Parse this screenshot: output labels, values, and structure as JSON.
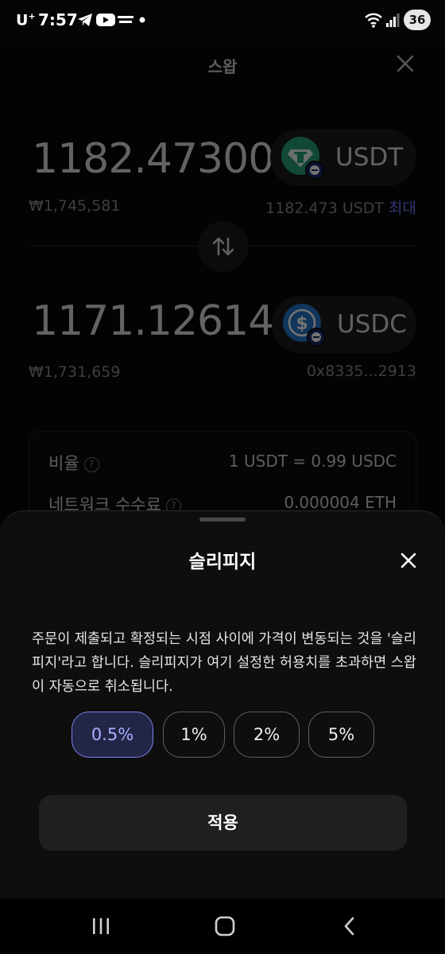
{
  "status_bar": {
    "carrier": "U",
    "carrier_sup": "+",
    "time": "7:57",
    "battery": "36",
    "colors": {
      "text": "#ffffff",
      "battery_bg": "#e6e6e6"
    }
  },
  "swap": {
    "title": "스왑",
    "from": {
      "amount": "1182.473002",
      "fiat": "₩1,745,581",
      "token": "USDT",
      "balance": "1182.473 USDT",
      "max_label": "최대"
    },
    "to": {
      "amount": "1171.12614",
      "fiat": "₩1,731,659",
      "token": "USDC",
      "address": "0x8335...2913"
    },
    "info": {
      "rate_label": "비율",
      "rate_value": "1 USDT = 0.99 USDC",
      "fee_label": "네트워크 수수료",
      "fee_value": "0.000004 ETH"
    },
    "help_glyph": "?",
    "colors": {
      "accent": "#6b7cff",
      "usdt": "#26a17b",
      "usdc": "#2775ca"
    }
  },
  "sheet": {
    "title": "슬리피지",
    "description": "주문이 제출되고 확정되는 시점 사이에 가격이 변동되는 것을 '슬리피지'라고 합니다. 슬리피지가 여기 설정한 허용치를 초과하면 스왑이 자동으로 취소됩니다.",
    "options": [
      "0.5%",
      "1%",
      "2%",
      "5%"
    ],
    "selected": "0.5%",
    "apply_label": "적용",
    "colors": {
      "selected_bg": "#222546",
      "selected_border": "#7a83e8",
      "selected_text": "#a8b0ff"
    }
  },
  "icons": {
    "page_close": "close-icon",
    "sheet_close": "close-icon",
    "swap": "swap-arrows-icon",
    "nav": [
      "recent-apps-icon",
      "home-icon",
      "back-icon"
    ]
  }
}
